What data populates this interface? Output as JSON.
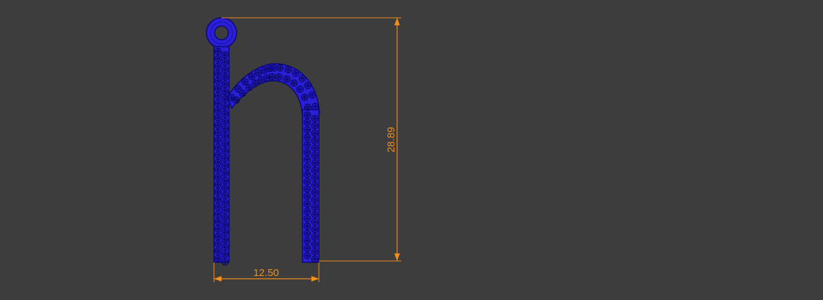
{
  "viewport": {
    "background": "#3d3d3d"
  },
  "model": {
    "glyph": "h",
    "fill_color": "#2a1ed6",
    "wire_color": "#0b0a70",
    "stone_outline_color": "#0a0862"
  },
  "dimensions": {
    "color": "#f0901a",
    "width_label": "12.50",
    "height_label": "28.89"
  }
}
